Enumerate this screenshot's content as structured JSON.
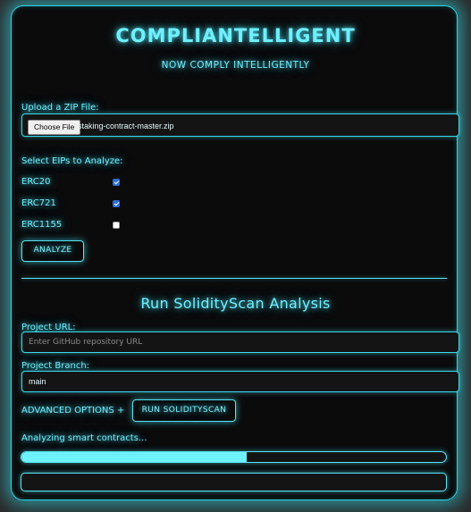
{
  "header": {
    "title": "COMPLIANTELLIGENT",
    "subtitle": "NOW COMPLY INTELLIGENTLY"
  },
  "upload": {
    "label": "Upload a ZIP File:",
    "choose_button": "Choose File",
    "file_name": "staking-contract-master.zip"
  },
  "eips": {
    "label": "Select EIPs to Analyze:",
    "items": [
      {
        "name": "ERC20",
        "checked": true
      },
      {
        "name": "ERC721",
        "checked": true
      },
      {
        "name": "ERC1155",
        "checked": false
      }
    ],
    "analyze_button": "ANALYZE"
  },
  "solidityscan": {
    "title": "Run SolidityScan Analysis",
    "project_url_label": "Project URL:",
    "project_url_placeholder": "Enter GitHub repository URL",
    "project_url_value": "",
    "branch_label": "Project Branch:",
    "branch_value": "main",
    "advanced_options": "ADVANCED OPTIONS +",
    "run_button": "RUN SOLIDITYSCAN"
  },
  "status": {
    "text": "Analyzing smart contracts...",
    "progress": 0.53
  },
  "colors": {
    "accent": "#6ff0ff",
    "background": "#0b0b0b",
    "page": "#2b2b2b"
  }
}
